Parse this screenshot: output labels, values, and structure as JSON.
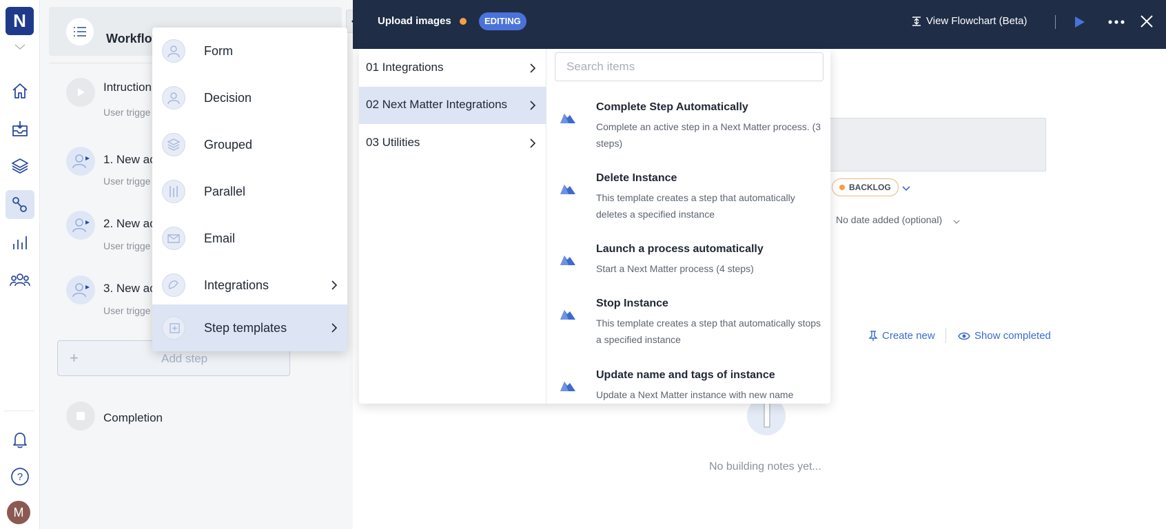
{
  "nav": {
    "logo_letter": "N",
    "avatar_initial": "M",
    "active_item": "workflows-icon"
  },
  "workflow": {
    "title": "Workflow",
    "steps": [
      {
        "title": "Intruction",
        "subtitle": "User trigge"
      },
      {
        "title": "1. New ac",
        "subtitle": "User trigge"
      },
      {
        "title": "2. New ac",
        "subtitle": "User trigge"
      },
      {
        "title": "3. New ac",
        "subtitle": "User trigge"
      }
    ],
    "add_step_label": "Add step",
    "add_step_plus": "+",
    "completion_label": "Completion"
  },
  "step_types": {
    "items": [
      {
        "label": "Form",
        "icon": "user-icon"
      },
      {
        "label": "Decision",
        "icon": "user-icon"
      },
      {
        "label": "Grouped",
        "icon": "stack-icon"
      },
      {
        "label": "Parallel",
        "icon": "parallel-icon"
      },
      {
        "label": "Email",
        "icon": "mail-icon"
      },
      {
        "label": "Integrations",
        "icon": "integration-icon"
      },
      {
        "label": "Step templates",
        "icon": "template-icon"
      }
    ],
    "active": "Step templates"
  },
  "topbar": {
    "title": "Upload images",
    "status_badge": "EDITING",
    "flowchart_label": "View Flowchart (Beta)",
    "status_dot_color": "#f5a142"
  },
  "integrations": {
    "categories": [
      {
        "label": "01 Integrations"
      },
      {
        "label": "02 Next Matter Integrations"
      },
      {
        "label": "03 Utilities"
      }
    ],
    "active_category": "02 Next Matter Integrations",
    "search_placeholder": "Search items",
    "search_value": "",
    "items": [
      {
        "title": "Complete Step Automatically",
        "description": "Complete an active step in a Next Matter process. (3 steps)"
      },
      {
        "title": "Delete Instance",
        "description": "This template creates a step that automatically deletes a specified instance"
      },
      {
        "title": "Launch a process automatically",
        "description": "Start a Next Matter process (4 steps)"
      },
      {
        "title": "Stop Instance",
        "description": "This template creates a step that automatically stops a specified instance"
      },
      {
        "title": "Update name and tags of instance",
        "description": "Update a Next Matter instance with new name"
      }
    ]
  },
  "background": {
    "status_badge": "BACKLOG",
    "date_placeholder": "No date added (optional)",
    "create_new_label": "Create new",
    "show_completed_label": "Show completed",
    "empty_notes": "No building notes yet..."
  },
  "colors": {
    "brand": "#1f3a8a",
    "topbar": "#1f2d47",
    "accent": "#3b6bd1",
    "active_row": "#dde4f3",
    "warning": "#f5a142"
  }
}
